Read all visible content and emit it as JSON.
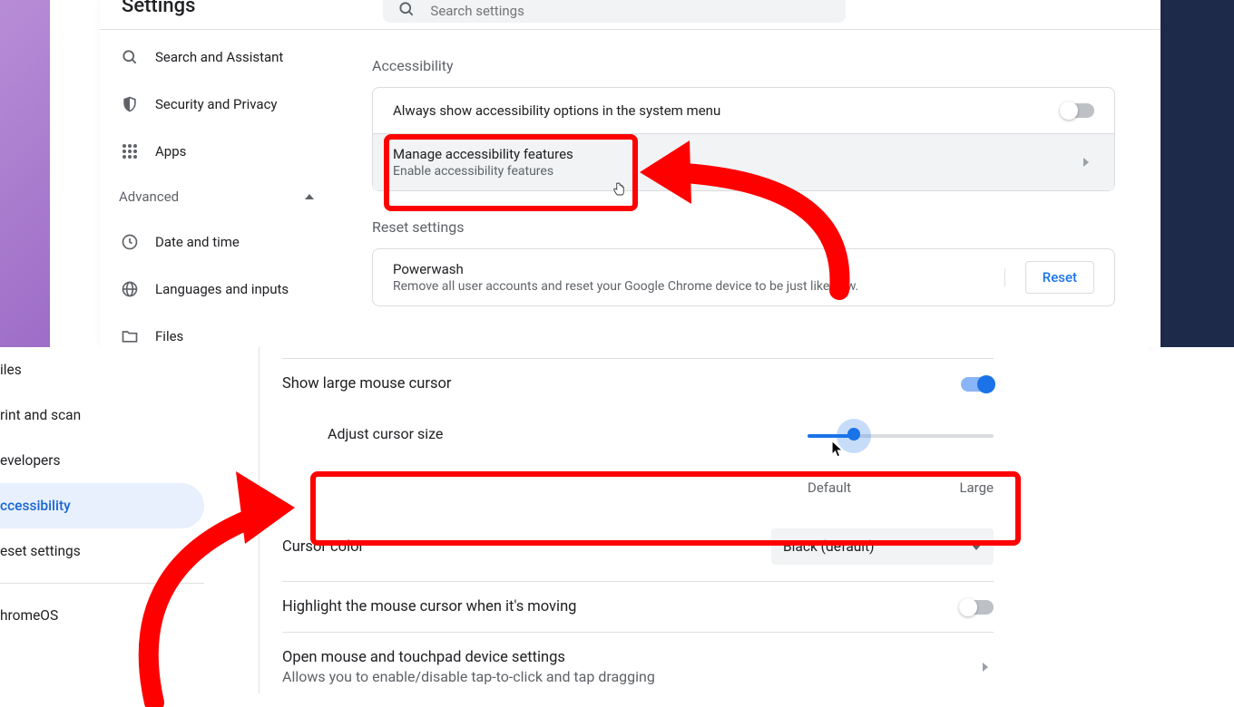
{
  "header": {
    "title": "Settings",
    "search_placeholder": "Search settings"
  },
  "sidebar_top": {
    "items": [
      {
        "label": "Search and Assistant"
      },
      {
        "label": "Security and Privacy"
      },
      {
        "label": "Apps"
      }
    ],
    "advanced_label": "Advanced",
    "advanced_items": [
      {
        "label": "Date and time"
      },
      {
        "label": "Languages and inputs"
      },
      {
        "label": "Files"
      }
    ]
  },
  "accessibility_section": {
    "title": "Accessibility",
    "always_show": "Always show accessibility options in the system menu",
    "manage_title": "Manage accessibility features",
    "manage_sub": "Enable accessibility features"
  },
  "reset_section": {
    "title": "Reset settings",
    "powerwash_title": "Powerwash",
    "powerwash_sub": "Remove all user accounts and reset your Google Chrome device to be just like new.",
    "reset_btn": "Reset"
  },
  "sidebar_bot": {
    "items": [
      {
        "label": "iles"
      },
      {
        "label": "rint and scan"
      },
      {
        "label": "evelopers"
      },
      {
        "label": "ccessibility"
      },
      {
        "label": "eset settings"
      },
      {
        "label": "hromeOS"
      }
    ]
  },
  "mouse": {
    "large_cursor": "Show large mouse cursor",
    "adjust_size": "Adjust cursor size",
    "size_min": "Default",
    "size_max": "Large",
    "cursor_color": "Cursor color",
    "cursor_color_value": "Black (default)",
    "highlight_moving": "Highlight the mouse cursor when it's moving",
    "device_title": "Open mouse and touchpad device settings",
    "device_sub": "Allows you to enable/disable tap-to-click and tap dragging"
  }
}
